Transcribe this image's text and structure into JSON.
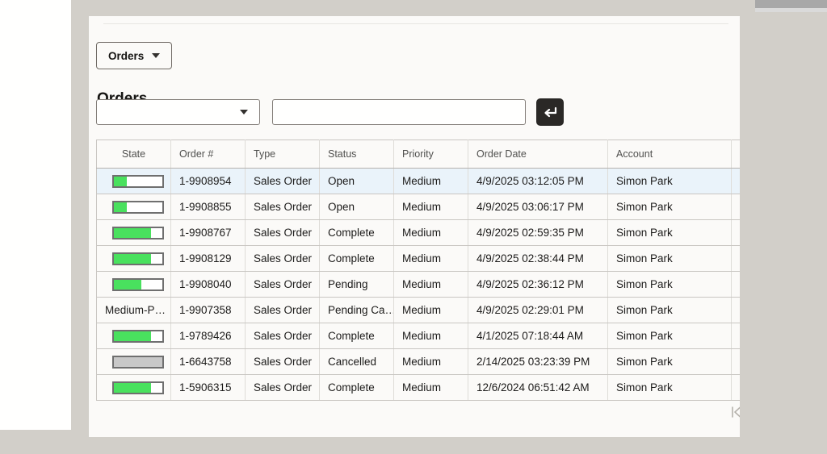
{
  "toolbar": {
    "orders_menu_label": "Orders"
  },
  "page_title": "Orders",
  "filters": {
    "dropdown_value": "",
    "search_value": ""
  },
  "table": {
    "columns": [
      {
        "label": "State",
        "align": "center"
      },
      {
        "label": "Order #",
        "align": "left"
      },
      {
        "label": "Type",
        "align": "left"
      },
      {
        "label": "Status",
        "align": "left"
      },
      {
        "label": "Priority",
        "align": "left"
      },
      {
        "label": "Order Date",
        "align": "left"
      },
      {
        "label": "Account",
        "align": "left"
      },
      {
        "label": "",
        "align": "left"
      }
    ],
    "rows": [
      {
        "state": {
          "kind": "bar",
          "percent": 28,
          "fill": "#49e15e"
        },
        "order_number": "1-9908954",
        "type": "Sales Order",
        "status": "Open",
        "priority": "Medium",
        "order_date": "4/9/2025 03:12:05 PM",
        "account": "Simon Park",
        "selected": true
      },
      {
        "state": {
          "kind": "bar",
          "percent": 28,
          "fill": "#49e15e"
        },
        "order_number": "1-9908855",
        "type": "Sales Order",
        "status": "Open",
        "priority": "Medium",
        "order_date": "4/9/2025 03:06:17 PM",
        "account": "Simon Park",
        "selected": false
      },
      {
        "state": {
          "kind": "bar",
          "percent": 78,
          "fill": "#49e15e"
        },
        "order_number": "1-9908767",
        "type": "Sales Order",
        "status": "Complete",
        "priority": "Medium",
        "order_date": "4/9/2025 02:59:35 PM",
        "account": "Simon Park",
        "selected": false
      },
      {
        "state": {
          "kind": "bar",
          "percent": 78,
          "fill": "#49e15e"
        },
        "order_number": "1-9908129",
        "type": "Sales Order",
        "status": "Complete",
        "priority": "Medium",
        "order_date": "4/9/2025 02:38:44 PM",
        "account": "Simon Park",
        "selected": false
      },
      {
        "state": {
          "kind": "bar",
          "percent": 58,
          "fill": "#49e15e"
        },
        "order_number": "1-9908040",
        "type": "Sales Order",
        "status": "Pending",
        "priority": "Medium",
        "order_date": "4/9/2025 02:36:12 PM",
        "account": "Simon Park",
        "selected": false
      },
      {
        "state": {
          "kind": "text",
          "text": "Medium-Pe…"
        },
        "order_number": "1-9907358",
        "type": "Sales Order",
        "status": "Pending Ca…",
        "priority": "Medium",
        "order_date": "4/9/2025 02:29:01 PM",
        "account": "Simon Park",
        "selected": false
      },
      {
        "state": {
          "kind": "bar",
          "percent": 78,
          "fill": "#49e15e"
        },
        "order_number": "1-9789426",
        "type": "Sales Order",
        "status": "Complete",
        "priority": "Medium",
        "order_date": "4/1/2025 07:18:44 AM",
        "account": "Simon Park",
        "selected": false
      },
      {
        "state": {
          "kind": "bar",
          "percent": 100,
          "fill": "#c8c8c8"
        },
        "order_number": "1-6643758",
        "type": "Sales Order",
        "status": "Cancelled",
        "priority": "Medium",
        "order_date": "2/14/2025 03:23:39 PM",
        "account": "Simon Park",
        "selected": false
      },
      {
        "state": {
          "kind": "bar",
          "percent": 78,
          "fill": "#49e15e"
        },
        "order_number": "1-5906315",
        "type": "Sales Order",
        "status": "Complete",
        "priority": "Medium",
        "order_date": "12/6/2024 06:51:42 AM",
        "account": "Simon Park",
        "selected": false
      }
    ]
  },
  "pagination": {
    "first_page_icon": "first-page"
  },
  "colors": {
    "link": "#1a6794",
    "selected_row": "#eaf3fa",
    "bar_green": "#49e15e",
    "bar_gray": "#c8c8c8",
    "background": "#d2cfc9",
    "card": "#fbfaf8"
  }
}
